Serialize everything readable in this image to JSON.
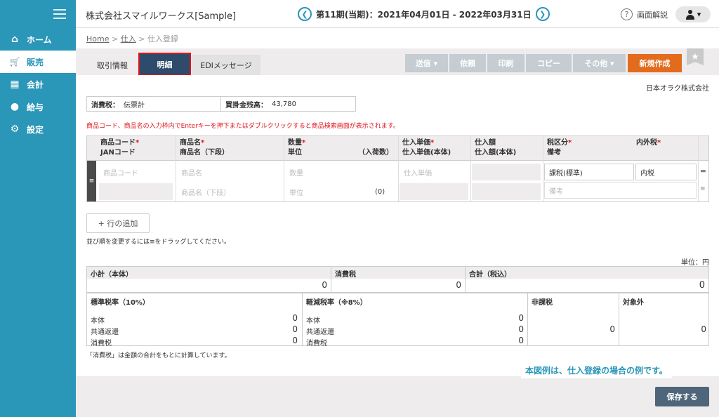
{
  "sidebar": {
    "items": [
      {
        "label": "ホーム",
        "icon": "home-icon",
        "glyph": "⌂"
      },
      {
        "label": "販売",
        "icon": "cart-icon",
        "glyph": "🛒"
      },
      {
        "label": "会計",
        "icon": "calculator-icon",
        "glyph": "▦"
      },
      {
        "label": "給与",
        "icon": "money-bag-icon",
        "glyph": "●"
      },
      {
        "label": "設定",
        "icon": "gear-icon",
        "glyph": "⚙"
      }
    ],
    "active_index": 1
  },
  "header": {
    "company": "株式会社スマイルワークス[Sample]",
    "period": "第11期(当期)：2021年04月01日 - 2022年03月31日",
    "prev_glyph": "❮",
    "next_glyph": "❯",
    "help_label": "画面解説",
    "help_glyph": "?",
    "user_caret": "▾"
  },
  "breadcrumb": {
    "home": "Home",
    "sep": ">",
    "purchase": "仕入",
    "current": "仕入登録"
  },
  "tabs": {
    "tab1": "取引情報",
    "tab2": "明細",
    "tab3": "EDIメッセージ"
  },
  "toolbar": {
    "send": "送信 ▾",
    "request": "依頼",
    "print": "印刷",
    "copy": "コピー",
    "other": "その他 ▾",
    "new": "新規作成",
    "star": "★"
  },
  "supplier": "日本オラク株式会社",
  "info": {
    "tax_label": "消費税：",
    "tax_value": "伝票計",
    "balance_label": "買掛金残高：",
    "balance_value": "43,780"
  },
  "notice": "商品コード、商品名の入力枠内でEnterキーを押下またはダブルクリックすると商品検索画面が表示されます。",
  "grid": {
    "headers": {
      "code": "商品コード",
      "jan": "JANコード",
      "name": "商品名",
      "name_lower": "商品名（下段）",
      "qty": "数量",
      "unit": "単位",
      "per_box": "（入荷数）",
      "price": "仕入単価",
      "price_body": "仕入単価(本体)",
      "amount": "仕入額",
      "amount_body": "仕入額(本体)",
      "tax_class": "税区分",
      "remark": "備考",
      "incl_excl": "内外税",
      "req": "*"
    },
    "row": {
      "code_ph": "商品コード",
      "name_ph": "商品名",
      "name_lower_ph": "商品名（下段）",
      "qty_ph": "数量",
      "unit_ph": "単位",
      "per_box_val": "(0)",
      "price_ph": "仕入単価",
      "tax_class": "課税(標準)",
      "incl_excl": "内税",
      "remark_ph": "備考",
      "handle": "≡",
      "icon_a": "▬",
      "icon_b": "≡"
    }
  },
  "add_row": "+ 行の追加",
  "drag_hint": "並び順を変更するには≡をドラッグしてください。",
  "unit_label": "単位：円",
  "totals": {
    "subtotal_label": "小計（本体）",
    "subtotal": "0",
    "tax_label": "消費税",
    "tax": "0",
    "total_label": "合計（税込）",
    "total": "0"
  },
  "tax_breakdown": {
    "std_label": "標準税率（10%）",
    "reduced_label": "軽減税率（※8%）",
    "nontax_label": "非課税",
    "exempt_label": "対象外",
    "body": "本体",
    "rebate": "共通返還",
    "tax": "消費税",
    "std_body": "0",
    "std_rebate": "0",
    "std_tax": "0",
    "red_body": "0",
    "red_rebate": "0",
    "red_tax": "0",
    "nontax": "0",
    "exempt": "0"
  },
  "calc_note": "「消費税」は金額の合計をもとに計算しています。",
  "caption": "本図例は、仕入登録の場合の例です。",
  "save": "保存する"
}
